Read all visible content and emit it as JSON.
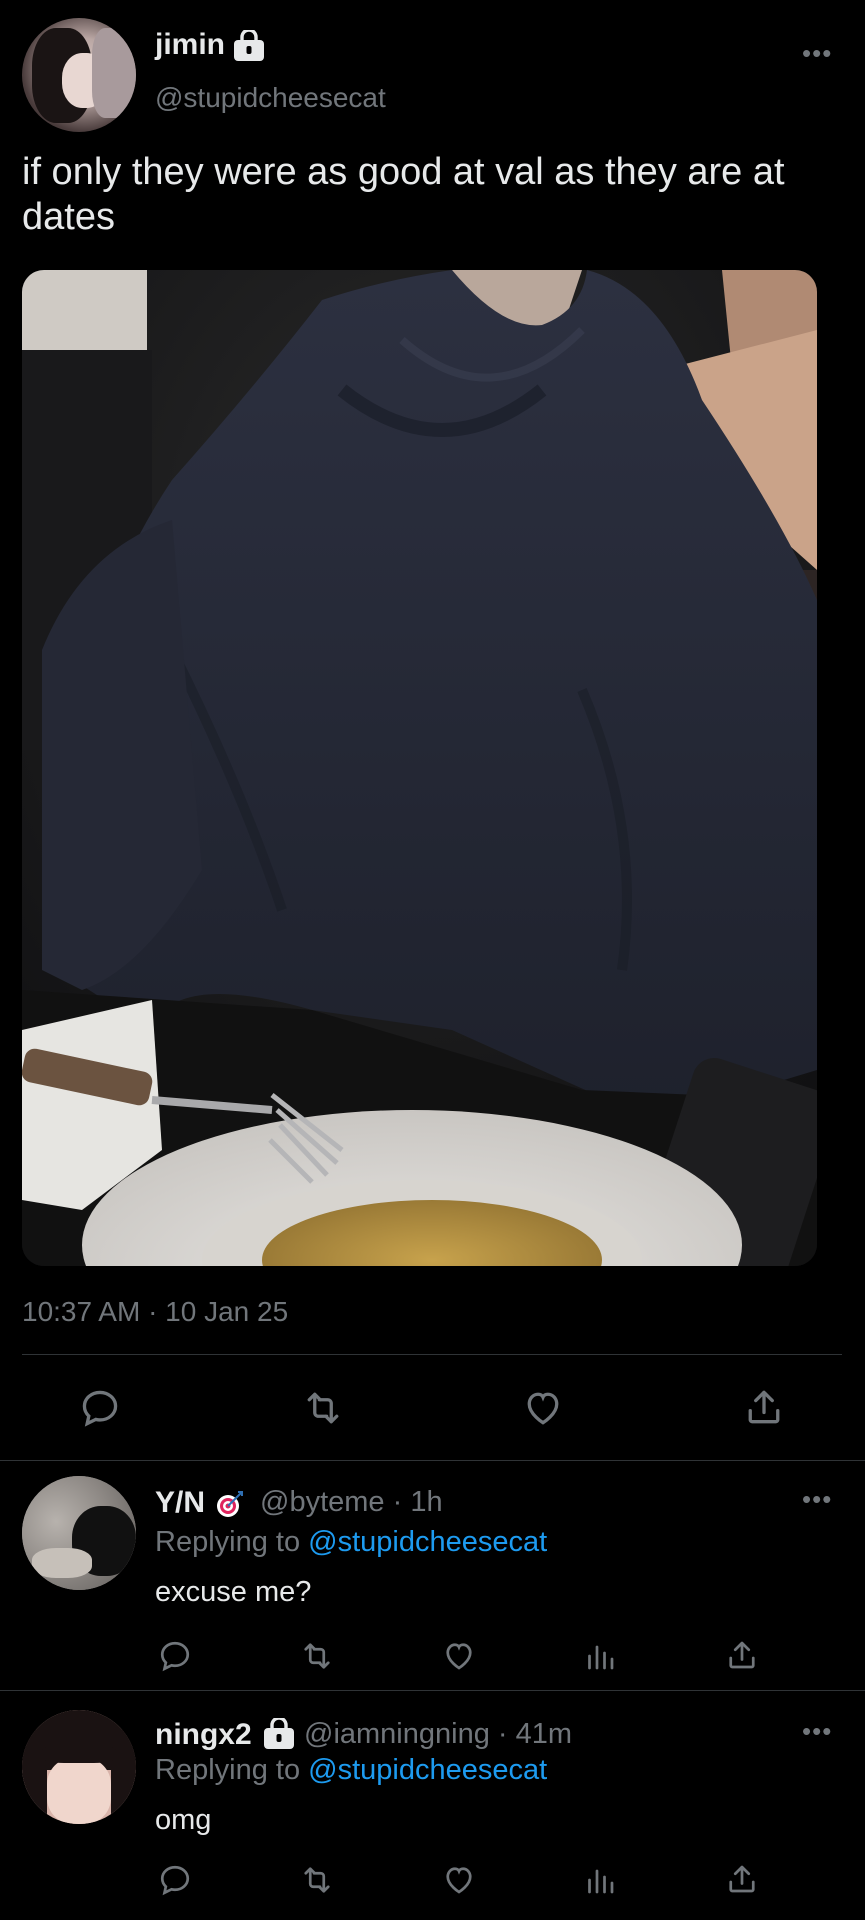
{
  "tweet": {
    "display_name": "jimin",
    "handle": "@stupidcheesecat",
    "text": "if only they were as good at val as they are at dates",
    "timestamp": "10:37 AM · 10 Jan 25",
    "locked": true
  },
  "replies": [
    {
      "display_name": "Y/N",
      "badge_icon": "target-emoji-icon",
      "handle": "@byteme",
      "time": "· 1h",
      "replying_prefix": "Replying to",
      "replying_to": "@stupidcheesecat",
      "text": "excuse me?"
    },
    {
      "display_name": "ningx2",
      "locked": true,
      "handle": "@iamningning",
      "time": "· 41m",
      "replying_prefix": "Replying to",
      "replying_to": "@stupidcheesecat",
      "text": "omg"
    }
  ],
  "colors": {
    "background": "#000000",
    "text": "#e7e9ea",
    "muted": "#71767b",
    "link": "#1d9bf0",
    "divider": "#2f3336"
  }
}
